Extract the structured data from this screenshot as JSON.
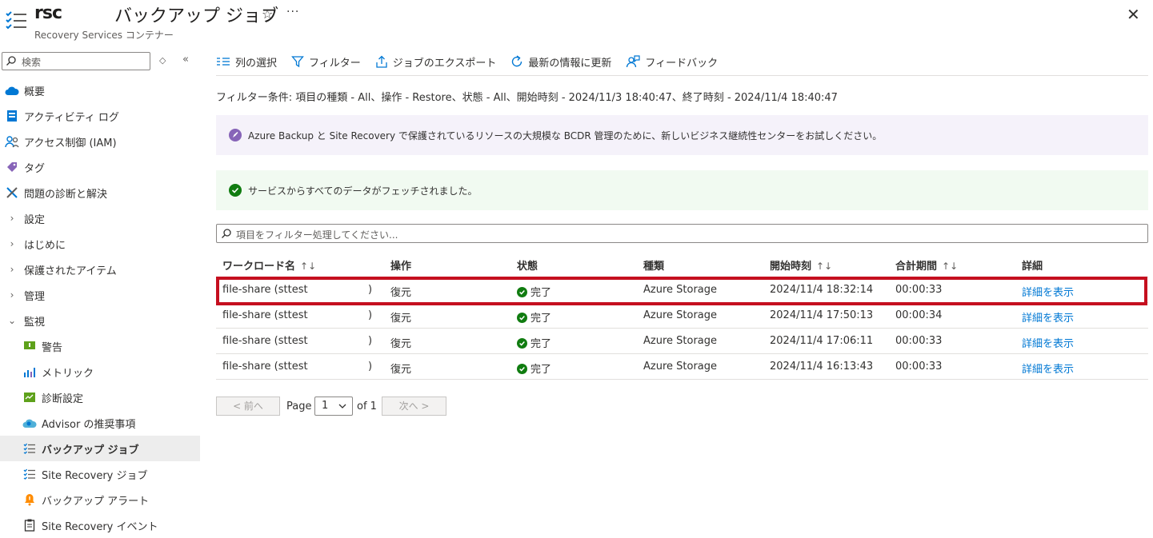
{
  "header": {
    "app_name": "rsc",
    "app_subtitle": "Recovery Services コンテナー",
    "page_title": "バックアップ ジョブ",
    "star": "☆",
    "more": "···",
    "close": "✕"
  },
  "sidebar": {
    "search_placeholder": "検索",
    "sort_glyph": "◇",
    "collapse_glyph": "«",
    "items": [
      {
        "label": "概要",
        "icon": "cloud-icon"
      },
      {
        "label": "アクティビティ ログ",
        "icon": "log-icon"
      },
      {
        "label": "アクセス制御 (IAM)",
        "icon": "people-icon"
      },
      {
        "label": "タグ",
        "icon": "tag-icon"
      },
      {
        "label": "問題の診断と解決",
        "icon": "wrench-icon"
      },
      {
        "label": "設定",
        "icon": "chevron-right-icon"
      },
      {
        "label": "はじめに",
        "icon": "chevron-right-icon"
      },
      {
        "label": "保護されたアイテム",
        "icon": "chevron-right-icon"
      },
      {
        "label": "管理",
        "icon": "chevron-right-icon"
      },
      {
        "label": "監視",
        "icon": "chevron-down-icon"
      },
      {
        "label": "警告",
        "icon": "alert-icon"
      },
      {
        "label": "メトリック",
        "icon": "metrics-icon"
      },
      {
        "label": "診断設定",
        "icon": "diagnostic-icon"
      },
      {
        "label": "Advisor の推奨事項",
        "icon": "advisor-icon"
      },
      {
        "label": "バックアップ ジョブ",
        "icon": "jobs-icon"
      },
      {
        "label": "Site Recovery ジョブ",
        "icon": "jobs-icon"
      },
      {
        "label": "バックアップ アラート",
        "icon": "bell-icon"
      },
      {
        "label": "Site Recovery イベント",
        "icon": "clipboard-icon"
      }
    ]
  },
  "toolbar": {
    "columns": "列の選択",
    "filter": "フィルター",
    "export": "ジョブのエクスポート",
    "refresh": "最新の情報に更新",
    "feedback": "フィードバック"
  },
  "filter_text": "フィルター条件: 項目の種類 - All、操作 - Restore、状態 - All、開始時刻 - 2024/11/3 18:40:47、終了時刻 - 2024/11/4 18:40:47",
  "banner_info": "Azure Backup と Site Recovery で保護されているリソースの大規模な BCDR 管理のために、新しいビジネス継続性センターをお試しください。",
  "banner_success": "サービスからすべてのデータがフェッチされました。",
  "grid_filter_placeholder": "項目をフィルター処理してください...",
  "table": {
    "headers": {
      "workload": "ワークロード名",
      "operation": "操作",
      "status": "状態",
      "type": "種類",
      "start": "開始時刻",
      "duration": "合計期間",
      "details": "詳細"
    },
    "sort_glyph": "↑↓",
    "rows": [
      {
        "workload": "file-share (sttest",
        "paren": ")",
        "operation": "復元",
        "status": "完了",
        "type": "Azure Storage",
        "start": "2024/11/4 18:32:14",
        "duration": "00:00:33",
        "details": "詳細を表示"
      },
      {
        "workload": "file-share (sttest",
        "paren": ")",
        "operation": "復元",
        "status": "完了",
        "type": "Azure Storage",
        "start": "2024/11/4 17:50:13",
        "duration": "00:00:34",
        "details": "詳細を表示"
      },
      {
        "workload": "file-share (sttest",
        "paren": ")",
        "operation": "復元",
        "status": "完了",
        "type": "Azure Storage",
        "start": "2024/11/4 17:06:11",
        "duration": "00:00:33",
        "details": "詳細を表示"
      },
      {
        "workload": "file-share (sttest",
        "paren": ")",
        "operation": "復元",
        "status": "完了",
        "type": "Azure Storage",
        "start": "2024/11/4 16:13:43",
        "duration": "00:00:33",
        "details": "詳細を表示"
      }
    ]
  },
  "pager": {
    "prev": "< 前へ",
    "page_label": "Page",
    "page_value": "1",
    "of_label": "of 1",
    "next": "次へ >"
  },
  "colors": {
    "accent": "#0078d4",
    "success": "#107c10",
    "highlight": "#c50f1f"
  }
}
